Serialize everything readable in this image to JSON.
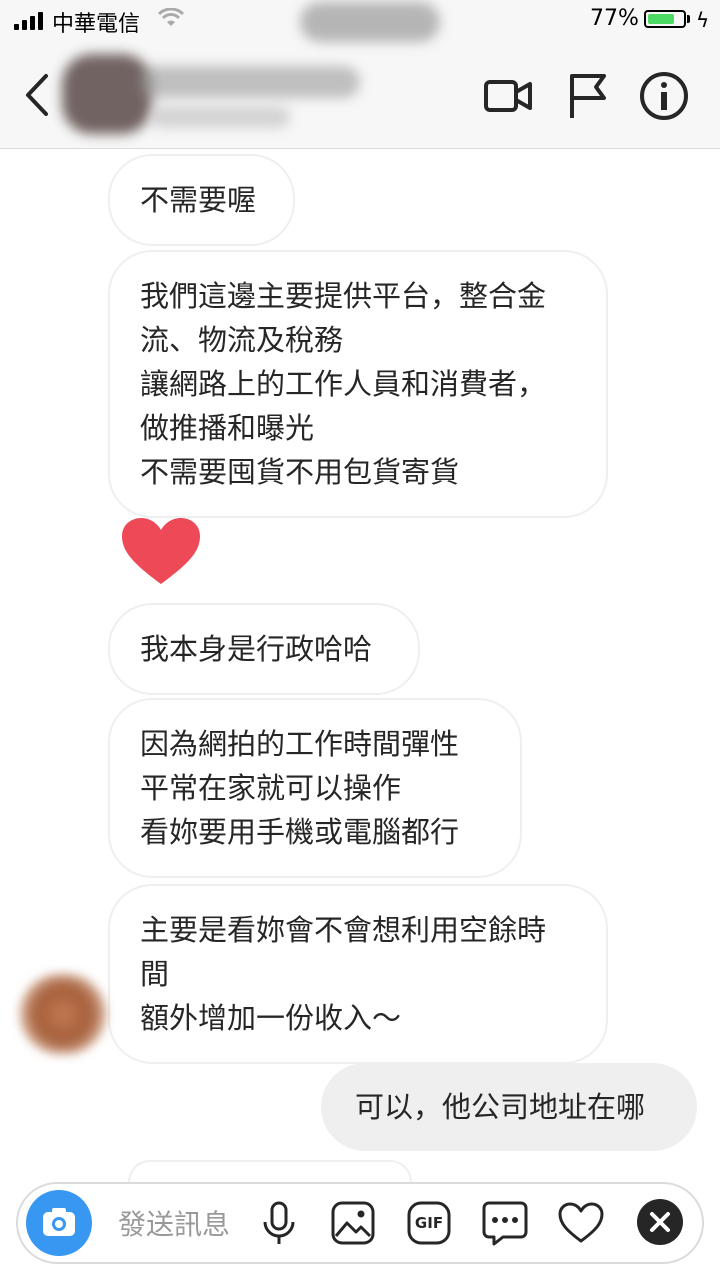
{
  "status_bar": {
    "carrier": "中華電信",
    "battery_percent": "77%",
    "battery_level": 0.77
  },
  "header": {
    "name": "",
    "subtitle": "",
    "icons": [
      "back-icon",
      "video-call-icon",
      "flag-icon",
      "info-icon"
    ]
  },
  "messages": [
    {
      "from": "other",
      "text": "不需要喔"
    },
    {
      "from": "other",
      "text": "我們這邊主要提供平台，整合金\n流、物流及稅務\n讓網路上的工作人員和消費者，\n做推播和曝光\n不需要囤貨不用包貨寄貨"
    },
    {
      "from": "other",
      "type": "heart",
      "icon": "heart-icon"
    },
    {
      "from": "other",
      "text": "我本身是行政哈哈"
    },
    {
      "from": "other",
      "text": "因為網拍的工作時間彈性\n平常在家就可以操作\n看妳要用手機或電腦都行"
    },
    {
      "from": "other",
      "text": "主要是看妳會不會想利用空餘時\n間\n額外增加一份收入～"
    },
    {
      "from": "me",
      "text": "可以，他公司地址在哪"
    }
  ],
  "composer": {
    "placeholder": "發送訊息",
    "gif_label": "GIF",
    "icons": [
      "camera-icon",
      "microphone-icon",
      "image-icon",
      "gif-icon",
      "more-icon",
      "heart-outline-icon",
      "close-icon"
    ]
  },
  "colors": {
    "accent_blue": "#3897f0",
    "heart_red": "#ed4956",
    "battery_green": "#4cd964",
    "bubble_border": "#efefef",
    "sent_bubble": "#efefef"
  }
}
